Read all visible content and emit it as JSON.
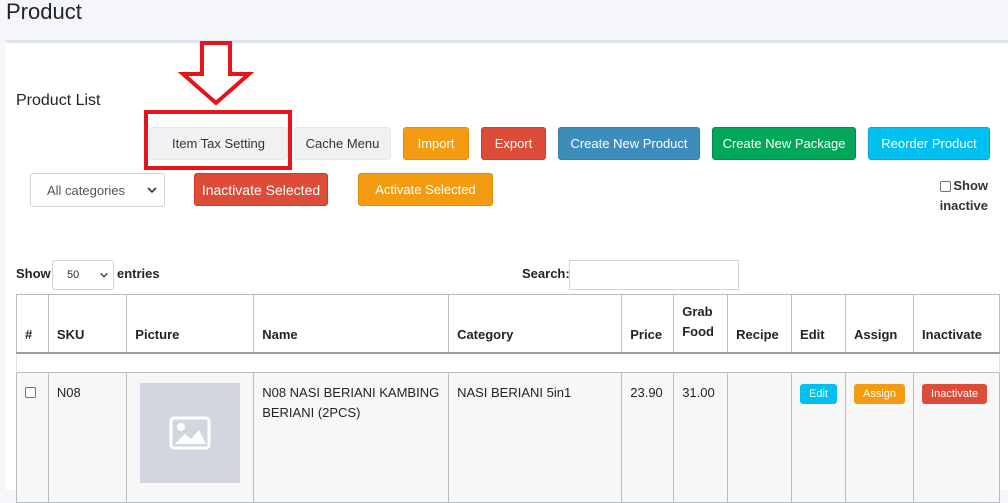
{
  "page": {
    "title": "Product"
  },
  "product_list": {
    "title": "Product List"
  },
  "toolbar": {
    "item_tax_setting": "Item Tax Setting",
    "cache_menu": "Cache Menu",
    "import": "Import",
    "export": "Export",
    "create_new_product": "Create New Product",
    "create_new_package": "Create New Package",
    "reorder_product": "Reorder Product"
  },
  "filters": {
    "category_select": "All categories",
    "inactivate_selected": "Inactivate Selected",
    "activate_selected": "Activate Selected",
    "show_inactive_line1": "Show",
    "show_inactive_line2": "inactive"
  },
  "table_controls": {
    "show_label": "Show",
    "entries_value": "50",
    "entries_label": "entries",
    "search_label": "Search:",
    "search_value": ""
  },
  "table": {
    "headers": {
      "num": "#",
      "sku": "SKU",
      "picture": "Picture",
      "name": "Name",
      "category": "Category",
      "price": "Price",
      "grab_food_line1": "Grab",
      "grab_food_line2": "Food",
      "recipe": "Recipe",
      "edit": "Edit",
      "assign": "Assign",
      "inactivate": "Inactivate"
    },
    "rows": [
      {
        "sku": "N08",
        "name": "N08 NASI BERIANI KAMBING BERIANI (2PCS)",
        "category": "NASI BERIANI 5in1",
        "price": "23.90",
        "grab_food": "31.00",
        "recipe": "",
        "edit_label": "Edit",
        "assign_label": "Assign",
        "inactivate_label": "Inactivate"
      }
    ]
  },
  "colors": {
    "highlight": "#e8141b",
    "warning": "#f39c12",
    "danger": "#dd4b39",
    "primary": "#3c8dbc",
    "success": "#00a65a",
    "info": "#00c0ef"
  },
  "icons": {
    "annotation_arrow": "down-arrow-icon",
    "select_chevron": "chevron-down-icon",
    "picture_placeholder": "image-placeholder-icon"
  }
}
